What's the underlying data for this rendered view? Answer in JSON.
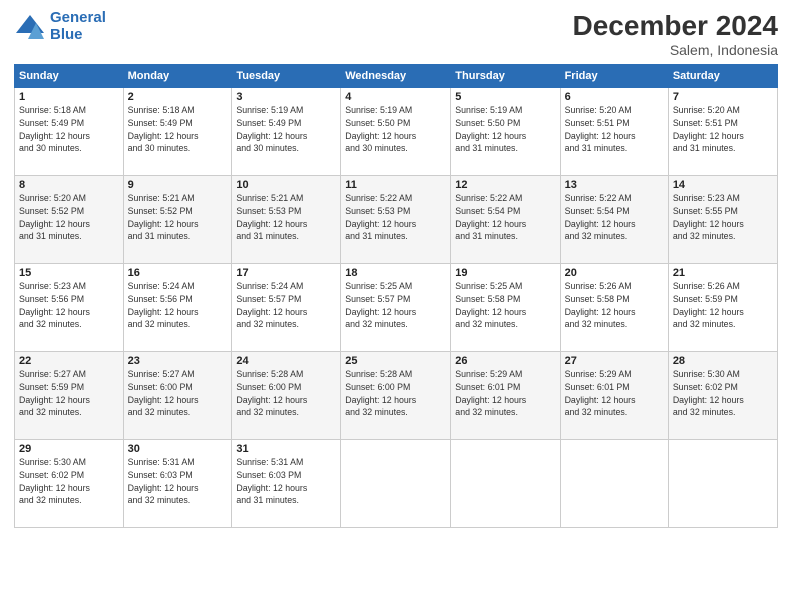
{
  "logo": {
    "line1": "General",
    "line2": "Blue"
  },
  "title": "December 2024",
  "subtitle": "Salem, Indonesia",
  "weekdays": [
    "Sunday",
    "Monday",
    "Tuesday",
    "Wednesday",
    "Thursday",
    "Friday",
    "Saturday"
  ],
  "weeks": [
    [
      {
        "day": "1",
        "info": "Sunrise: 5:18 AM\nSunset: 5:49 PM\nDaylight: 12 hours\nand 30 minutes."
      },
      {
        "day": "2",
        "info": "Sunrise: 5:18 AM\nSunset: 5:49 PM\nDaylight: 12 hours\nand 30 minutes."
      },
      {
        "day": "3",
        "info": "Sunrise: 5:19 AM\nSunset: 5:49 PM\nDaylight: 12 hours\nand 30 minutes."
      },
      {
        "day": "4",
        "info": "Sunrise: 5:19 AM\nSunset: 5:50 PM\nDaylight: 12 hours\nand 30 minutes."
      },
      {
        "day": "5",
        "info": "Sunrise: 5:19 AM\nSunset: 5:50 PM\nDaylight: 12 hours\nand 31 minutes."
      },
      {
        "day": "6",
        "info": "Sunrise: 5:20 AM\nSunset: 5:51 PM\nDaylight: 12 hours\nand 31 minutes."
      },
      {
        "day": "7",
        "info": "Sunrise: 5:20 AM\nSunset: 5:51 PM\nDaylight: 12 hours\nand 31 minutes."
      }
    ],
    [
      {
        "day": "8",
        "info": "Sunrise: 5:20 AM\nSunset: 5:52 PM\nDaylight: 12 hours\nand 31 minutes."
      },
      {
        "day": "9",
        "info": "Sunrise: 5:21 AM\nSunset: 5:52 PM\nDaylight: 12 hours\nand 31 minutes."
      },
      {
        "day": "10",
        "info": "Sunrise: 5:21 AM\nSunset: 5:53 PM\nDaylight: 12 hours\nand 31 minutes."
      },
      {
        "day": "11",
        "info": "Sunrise: 5:22 AM\nSunset: 5:53 PM\nDaylight: 12 hours\nand 31 minutes."
      },
      {
        "day": "12",
        "info": "Sunrise: 5:22 AM\nSunset: 5:54 PM\nDaylight: 12 hours\nand 31 minutes."
      },
      {
        "day": "13",
        "info": "Sunrise: 5:22 AM\nSunset: 5:54 PM\nDaylight: 12 hours\nand 32 minutes."
      },
      {
        "day": "14",
        "info": "Sunrise: 5:23 AM\nSunset: 5:55 PM\nDaylight: 12 hours\nand 32 minutes."
      }
    ],
    [
      {
        "day": "15",
        "info": "Sunrise: 5:23 AM\nSunset: 5:56 PM\nDaylight: 12 hours\nand 32 minutes."
      },
      {
        "day": "16",
        "info": "Sunrise: 5:24 AM\nSunset: 5:56 PM\nDaylight: 12 hours\nand 32 minutes."
      },
      {
        "day": "17",
        "info": "Sunrise: 5:24 AM\nSunset: 5:57 PM\nDaylight: 12 hours\nand 32 minutes."
      },
      {
        "day": "18",
        "info": "Sunrise: 5:25 AM\nSunset: 5:57 PM\nDaylight: 12 hours\nand 32 minutes."
      },
      {
        "day": "19",
        "info": "Sunrise: 5:25 AM\nSunset: 5:58 PM\nDaylight: 12 hours\nand 32 minutes."
      },
      {
        "day": "20",
        "info": "Sunrise: 5:26 AM\nSunset: 5:58 PM\nDaylight: 12 hours\nand 32 minutes."
      },
      {
        "day": "21",
        "info": "Sunrise: 5:26 AM\nSunset: 5:59 PM\nDaylight: 12 hours\nand 32 minutes."
      }
    ],
    [
      {
        "day": "22",
        "info": "Sunrise: 5:27 AM\nSunset: 5:59 PM\nDaylight: 12 hours\nand 32 minutes."
      },
      {
        "day": "23",
        "info": "Sunrise: 5:27 AM\nSunset: 6:00 PM\nDaylight: 12 hours\nand 32 minutes."
      },
      {
        "day": "24",
        "info": "Sunrise: 5:28 AM\nSunset: 6:00 PM\nDaylight: 12 hours\nand 32 minutes."
      },
      {
        "day": "25",
        "info": "Sunrise: 5:28 AM\nSunset: 6:00 PM\nDaylight: 12 hours\nand 32 minutes."
      },
      {
        "day": "26",
        "info": "Sunrise: 5:29 AM\nSunset: 6:01 PM\nDaylight: 12 hours\nand 32 minutes."
      },
      {
        "day": "27",
        "info": "Sunrise: 5:29 AM\nSunset: 6:01 PM\nDaylight: 12 hours\nand 32 minutes."
      },
      {
        "day": "28",
        "info": "Sunrise: 5:30 AM\nSunset: 6:02 PM\nDaylight: 12 hours\nand 32 minutes."
      }
    ],
    [
      {
        "day": "29",
        "info": "Sunrise: 5:30 AM\nSunset: 6:02 PM\nDaylight: 12 hours\nand 32 minutes."
      },
      {
        "day": "30",
        "info": "Sunrise: 5:31 AM\nSunset: 6:03 PM\nDaylight: 12 hours\nand 32 minutes."
      },
      {
        "day": "31",
        "info": "Sunrise: 5:31 AM\nSunset: 6:03 PM\nDaylight: 12 hours\nand 31 minutes."
      },
      {
        "day": "",
        "info": ""
      },
      {
        "day": "",
        "info": ""
      },
      {
        "day": "",
        "info": ""
      },
      {
        "day": "",
        "info": ""
      }
    ]
  ]
}
